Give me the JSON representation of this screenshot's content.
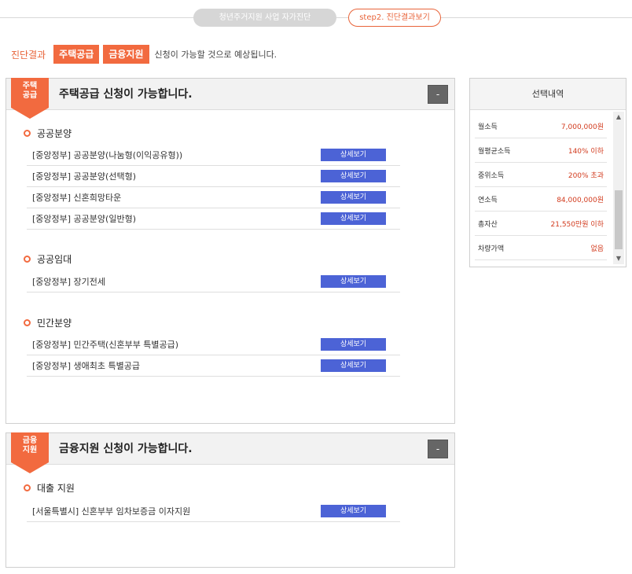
{
  "steps": {
    "step1": "청년주거지원 사업 자가진단",
    "step2": "step2. 진단결과보기"
  },
  "result": {
    "label": "진단결과",
    "badges": [
      "주택공급",
      "금융지원"
    ],
    "message": "신청이 가능할 것으로 예상됩니다."
  },
  "panels": [
    {
      "ribbon": "주택\n공급",
      "title": "주택공급 신청이 가능합니다.",
      "collapse": "-",
      "sections": [
        {
          "title": "공공분양",
          "items": [
            {
              "name": "[중앙정부] 공공분양(나눔형(이익공유형))",
              "button": "상세보기"
            },
            {
              "name": "[중앙정부] 공공분양(선택형)",
              "button": "상세보기"
            },
            {
              "name": "[중앙정부] 신혼희망타운",
              "button": "상세보기"
            },
            {
              "name": "[중앙정부] 공공분양(일반형)",
              "button": "상세보기"
            }
          ]
        },
        {
          "title": "공공임대",
          "items": [
            {
              "name": "[중앙정부] 장기전세",
              "button": "상세보기"
            }
          ]
        },
        {
          "title": "민간분양",
          "items": [
            {
              "name": "[중앙정부] 민간주택(신혼부부 특별공급)",
              "button": "상세보기"
            },
            {
              "name": "[중앙정부] 생애최초 특별공급",
              "button": "상세보기"
            }
          ]
        }
      ]
    },
    {
      "ribbon": "금융\n지원",
      "title": "금융지원 신청이 가능합니다.",
      "collapse": "-",
      "sections": [
        {
          "title": "대출 지원",
          "items": [
            {
              "name": "[서울특별시] 신혼부부 임차보증금 이자지원",
              "button": "상세보기"
            }
          ]
        }
      ]
    }
  ],
  "side": {
    "title": "선택내역",
    "items": [
      {
        "k": "월소득",
        "v": "7,000,000원"
      },
      {
        "k": "월평균소득",
        "v": "140% 이하"
      },
      {
        "k": "중위소득",
        "v": "200% 초과"
      },
      {
        "k": "연소득",
        "v": "84,000,000원"
      },
      {
        "k": "총자산",
        "v": "21,550만원 이하"
      },
      {
        "k": "차량가액",
        "v": "없음"
      }
    ]
  },
  "colors": {
    "accent": "#f26a3f",
    "button": "#4c63d6",
    "value": "#d23b1e"
  }
}
